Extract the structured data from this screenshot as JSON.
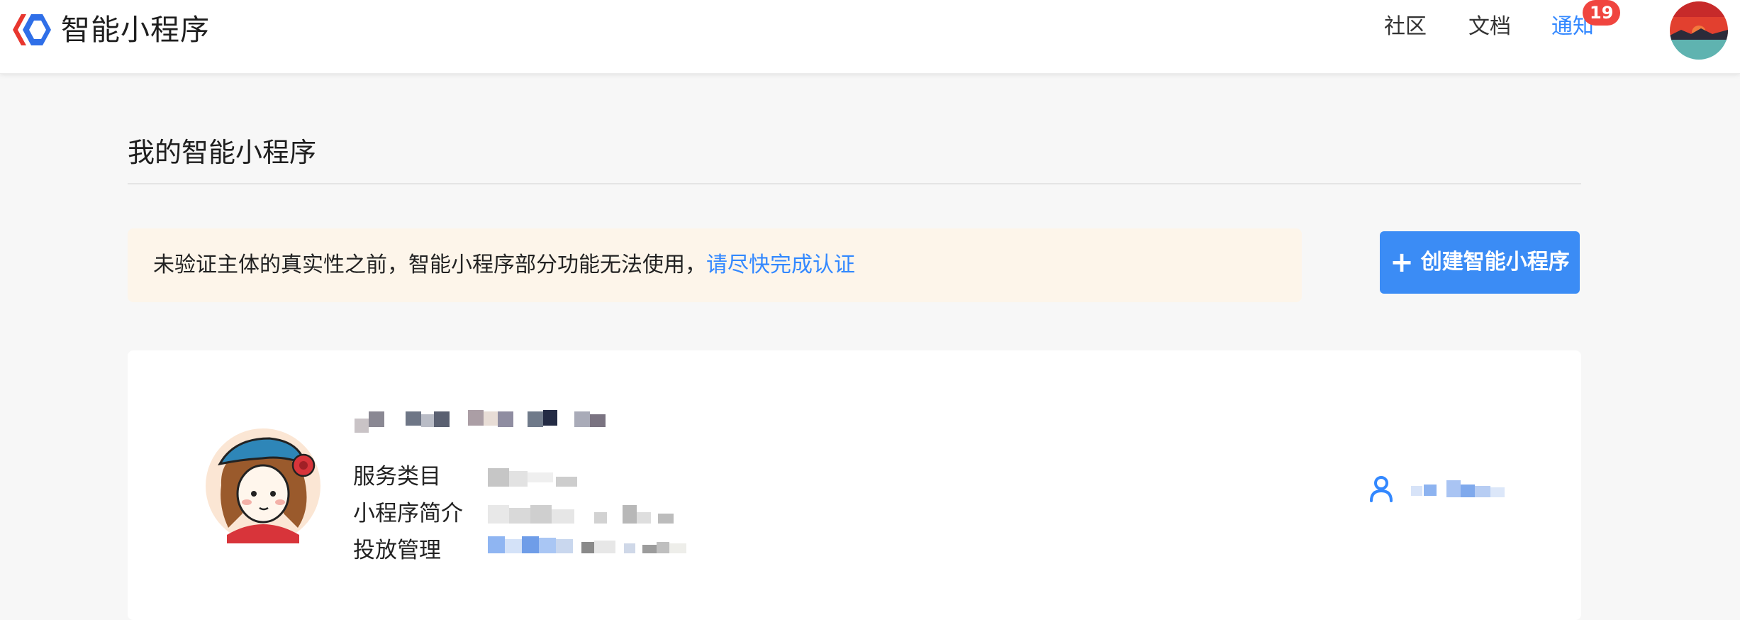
{
  "header": {
    "brand_title": "智能小程序",
    "logo_icon": "diamond-logo-icon",
    "nav": {
      "community": "社区",
      "docs": "文档",
      "notice": "通知"
    },
    "notice_count": "19",
    "avatar_icon": "sunset-avatar-icon"
  },
  "main": {
    "page_title": "我的智能小程序",
    "warning": {
      "text": "未验证主体的真实性之前，智能小程序部分功能无法使用，",
      "link_text": "请尽快完成认证"
    },
    "create_button": {
      "icon": "plus-icon",
      "label": "创建智能小程序"
    },
    "app_card": {
      "avatar_icon": "girl-avatar-icon",
      "labels": {
        "category": "服务类目",
        "description": "小程序简介",
        "manage": "投放管理"
      },
      "owner_icon": "user-icon"
    }
  },
  "colors": {
    "accent": "#3388ff",
    "button": "#3b8cf5",
    "badge": "#f0453f",
    "warning_bg": "#fdf5ea",
    "page_bg": "#f7f7f7"
  }
}
